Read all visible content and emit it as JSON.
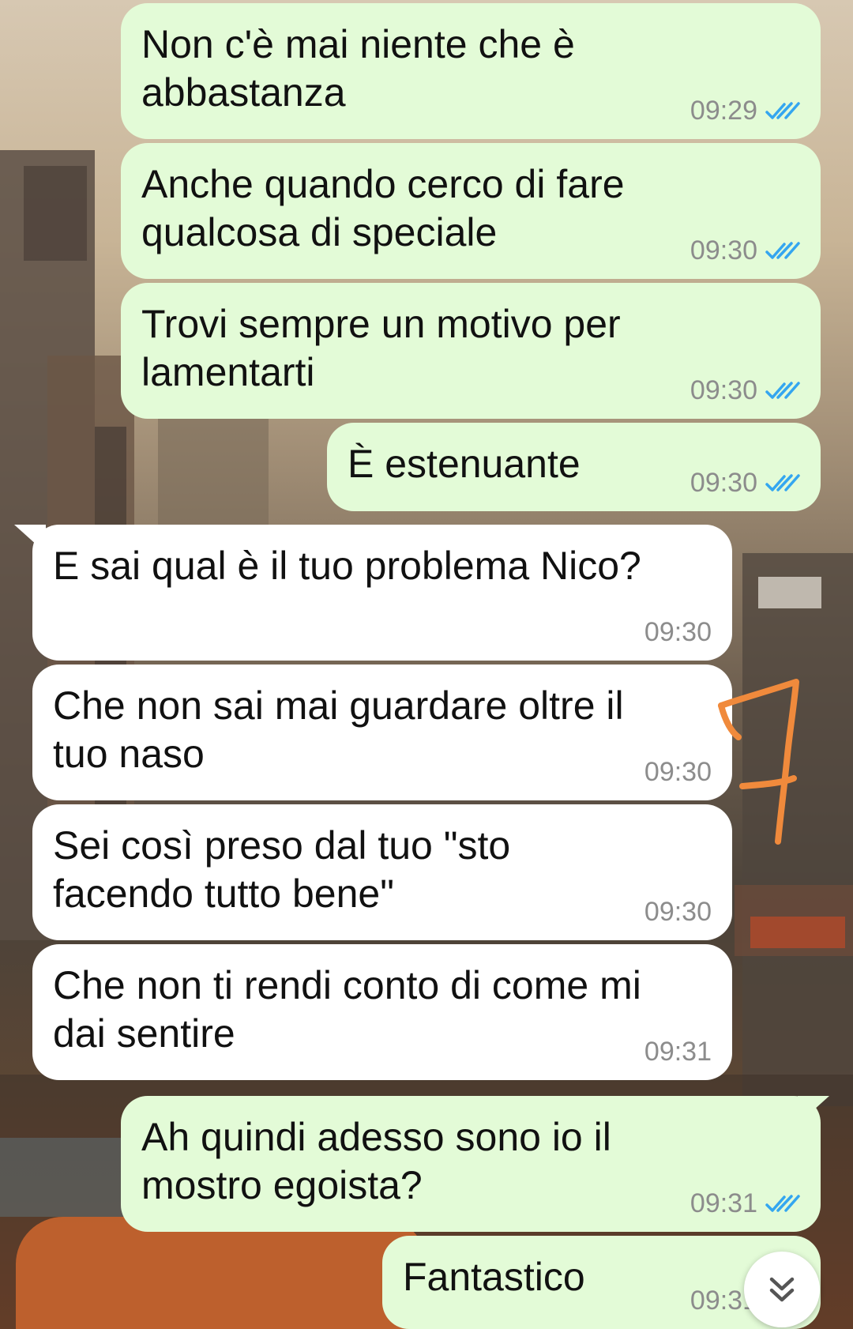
{
  "colors": {
    "outgoing_bubble": "#e3fbd7",
    "incoming_bubble": "#ffffff",
    "read_ticks": "#34a6f0",
    "timestamp": "#8c8c8c",
    "annotation_mark": "#f08a3c"
  },
  "messages": [
    {
      "direction": "out",
      "text": "Non c'è mai niente che è\nabbastanza",
      "time": "09:29",
      "status": "read"
    },
    {
      "direction": "out",
      "text": "Anche quando cerco di fare\nqualcosa di speciale",
      "time": "09:30",
      "status": "read"
    },
    {
      "direction": "out",
      "text": "Trovi sempre un motivo per\nlamentarti",
      "time": "09:30",
      "status": "read"
    },
    {
      "direction": "out",
      "text": "È estenuante",
      "time": "09:30",
      "status": "read"
    },
    {
      "direction": "in",
      "text": "E sai qual è il tuo problema Nico?",
      "time": "09:30"
    },
    {
      "direction": "in",
      "text": "Che non sai mai guardare oltre il\ntuo naso",
      "time": "09:30"
    },
    {
      "direction": "in",
      "text": "Sei così preso dal tuo \"sto\nfacendo tutto bene\"",
      "time": "09:30"
    },
    {
      "direction": "in",
      "text": "Che non ti rendi conto di come mi\ndai sentire",
      "time": "09:31"
    },
    {
      "direction": "out",
      "text": "Ah quindi adesso sono io il\nmostro egoista?",
      "time": "09:31",
      "status": "read"
    },
    {
      "direction": "out",
      "text": "Fantastico",
      "time": "09:31",
      "status": "read"
    }
  ],
  "annotation": {
    "icon": "hand-drawn-seven-mark"
  },
  "scroll_button": {
    "icon": "double-chevron-down-icon"
  }
}
